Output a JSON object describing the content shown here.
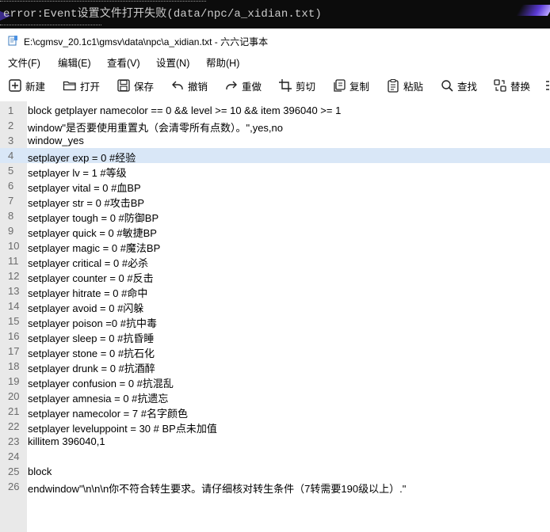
{
  "console": {
    "message": "error:Event设置文件打开失败(data/npc/a_xidian.txt)"
  },
  "window": {
    "title": "E:\\cgmsv_20.1c1\\gmsv\\data\\npc\\a_xidian.txt - 六六记事本",
    "file_icon": "notepad-file-icon"
  },
  "menu": [
    "文件(F)",
    "编辑(E)",
    "查看(V)",
    "设置(N)",
    "帮助(H)"
  ],
  "toolbar": [
    {
      "label": "新建",
      "icon": "new-icon"
    },
    {
      "label": "打开",
      "icon": "folder-open-icon"
    },
    {
      "label": "保存",
      "icon": "save-icon"
    },
    {
      "label": "撤销",
      "icon": "undo-icon"
    },
    {
      "label": "重做",
      "icon": "redo-icon"
    },
    {
      "label": "剪切",
      "icon": "crop-cut-icon"
    },
    {
      "label": "复制",
      "icon": "copy-icon"
    },
    {
      "label": "粘贴",
      "icon": "paste-icon"
    },
    {
      "label": "查找",
      "icon": "search-icon"
    },
    {
      "label": "替换",
      "icon": "replace-icon"
    }
  ],
  "editor": {
    "current_line": 4,
    "highlight_color": "#d9e7f7",
    "lines": [
      "block getplayer namecolor == 0 && level >= 10 && item 396040 >= 1",
      "window\"是否要使用重置丸（会清零所有点数）。\",yes,no",
      "window_yes",
      "setplayer exp = 0 #经验",
      "setplayer lv = 1 #等级",
      "setplayer vital = 0 #血BP",
      "setplayer str = 0 #攻击BP",
      "setplayer tough = 0 #防御BP",
      "setplayer quick = 0 #敏捷BP",
      "setplayer magic = 0 #魔法BP",
      "setplayer critical = 0 #必杀",
      "setplayer counter = 0 #反击",
      "setplayer hitrate = 0 #命中",
      "setplayer avoid = 0 #闪躲",
      "setplayer poison =0 #抗中毒",
      "setplayer sleep = 0 #抗昏睡",
      "setplayer stone = 0 #抗石化",
      "setplayer drunk = 0 #抗酒醉",
      "setplayer confusion = 0 #抗混乱",
      "setplayer amnesia = 0 #抗遗忘",
      "setplayer namecolor = 7 #名字颜色",
      "setplayer leveluppoint = 30 # BP点未加值",
      "killitem 396040,1",
      "",
      "block",
      "endwindow\"\\n\\n\\n你不符合转生要求。请仔细核对转生条件（7转需要190级以上）.\""
    ]
  }
}
